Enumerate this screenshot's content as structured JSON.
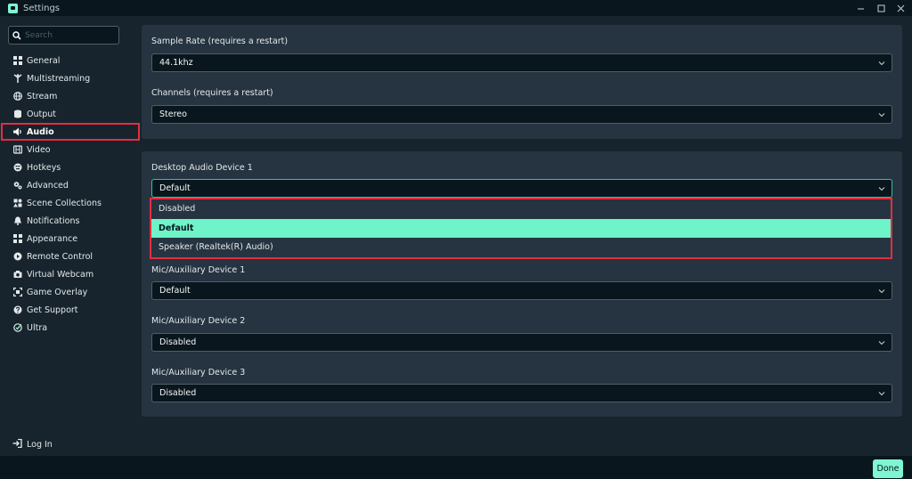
{
  "window": {
    "title": "Settings"
  },
  "search": {
    "placeholder": "Search",
    "value": ""
  },
  "sidebar": {
    "items": [
      {
        "label": "General",
        "icon": "grid-icon"
      },
      {
        "label": "Multistreaming",
        "icon": "multistream-icon"
      },
      {
        "label": "Stream",
        "icon": "globe-icon"
      },
      {
        "label": "Output",
        "icon": "database-icon"
      },
      {
        "label": "Audio",
        "icon": "speaker-icon",
        "active": true
      },
      {
        "label": "Video",
        "icon": "film-icon"
      },
      {
        "label": "Hotkeys",
        "icon": "keyboard-icon"
      },
      {
        "label": "Advanced",
        "icon": "gears-icon"
      },
      {
        "label": "Scene Collections",
        "icon": "collections-icon"
      },
      {
        "label": "Notifications",
        "icon": "bell-icon"
      },
      {
        "label": "Appearance",
        "icon": "grid-icon"
      },
      {
        "label": "Remote Control",
        "icon": "play-circle-icon"
      },
      {
        "label": "Virtual Webcam",
        "icon": "camera-icon"
      },
      {
        "label": "Game Overlay",
        "icon": "overlay-icon"
      },
      {
        "label": "Get Support",
        "icon": "question-icon"
      },
      {
        "label": "Ultra",
        "icon": "ultra-icon"
      }
    ],
    "login_label": "Log In"
  },
  "audio_settings": {
    "sample_rate": {
      "label": "Sample Rate (requires a restart)",
      "value": "44.1khz"
    },
    "channels": {
      "label": "Channels (requires a restart)",
      "value": "Stereo"
    },
    "desktop_audio_1": {
      "label": "Desktop Audio Device 1",
      "value": "Default",
      "options": [
        "Disabled",
        "Default",
        "Speaker (Realtek(R) Audio)"
      ],
      "selected_option": "Default"
    },
    "mic_aux_1": {
      "label": "Mic/Auxiliary Device 1",
      "value": "Default"
    },
    "mic_aux_2": {
      "label": "Mic/Auxiliary Device 2",
      "value": "Disabled"
    },
    "mic_aux_3": {
      "label": "Mic/Auxiliary Device 3",
      "value": "Disabled"
    }
  },
  "footer": {
    "done_label": "Done"
  },
  "colors": {
    "accent": "#80f5d2",
    "highlight_box": "#e52d3e",
    "background": "#17242d",
    "card": "#263441",
    "titlebar": "#09161d"
  }
}
